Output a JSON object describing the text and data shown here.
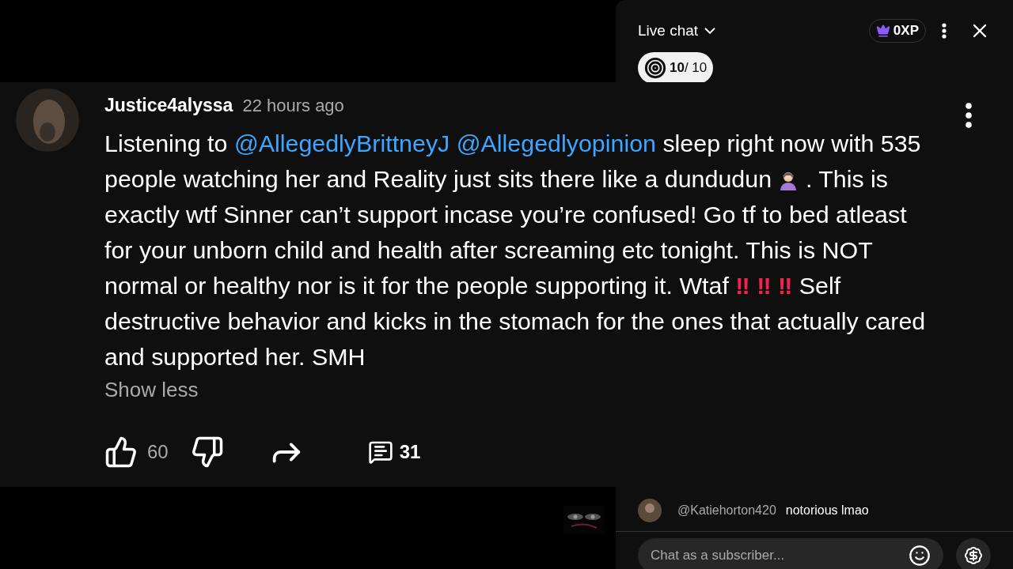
{
  "chat": {
    "title": "Live chat",
    "xp": "0XP",
    "goal": {
      "done": "10",
      "total": "/ 10"
    },
    "messages": [
      {
        "author": "@Katiehorton420",
        "text": "notorious lmao"
      }
    ],
    "input": {
      "placeholder": "Chat as a subscriber..."
    }
  },
  "comment": {
    "author": "Justice4alyssa",
    "time": "22 hours ago",
    "body": [
      {
        "kind": "text",
        "text": "Listening to "
      },
      {
        "kind": "mention",
        "text": "@AllegedlyBrittneyJ "
      },
      {
        "kind": "mention",
        "text": "@Allegedlyopinion"
      },
      {
        "kind": "text",
        "text": " sleep right now with 535 people watching her and Reality just sits there like a dundudun "
      },
      {
        "kind": "emoji"
      },
      {
        "kind": "text",
        "text": " . This is exactly wtf Sinner can’t support incase you’re confused! Go tf to bed atleast for your unborn child and health after screaming etc tonight. This is NOT normal or healthy nor is it for the people supporting it. Wtaf "
      },
      {
        "kind": "alert",
        "text": "‼ "
      },
      {
        "kind": "alert",
        "text": "‼ "
      },
      {
        "kind": "alert",
        "text": "‼"
      },
      {
        "kind": "text",
        "text": " Self destructive behavior and kicks in the stomach for the ones that actually cared and supported her. SMH"
      }
    ],
    "toggle": "Show less",
    "likes": "60",
    "replies": "31"
  }
}
